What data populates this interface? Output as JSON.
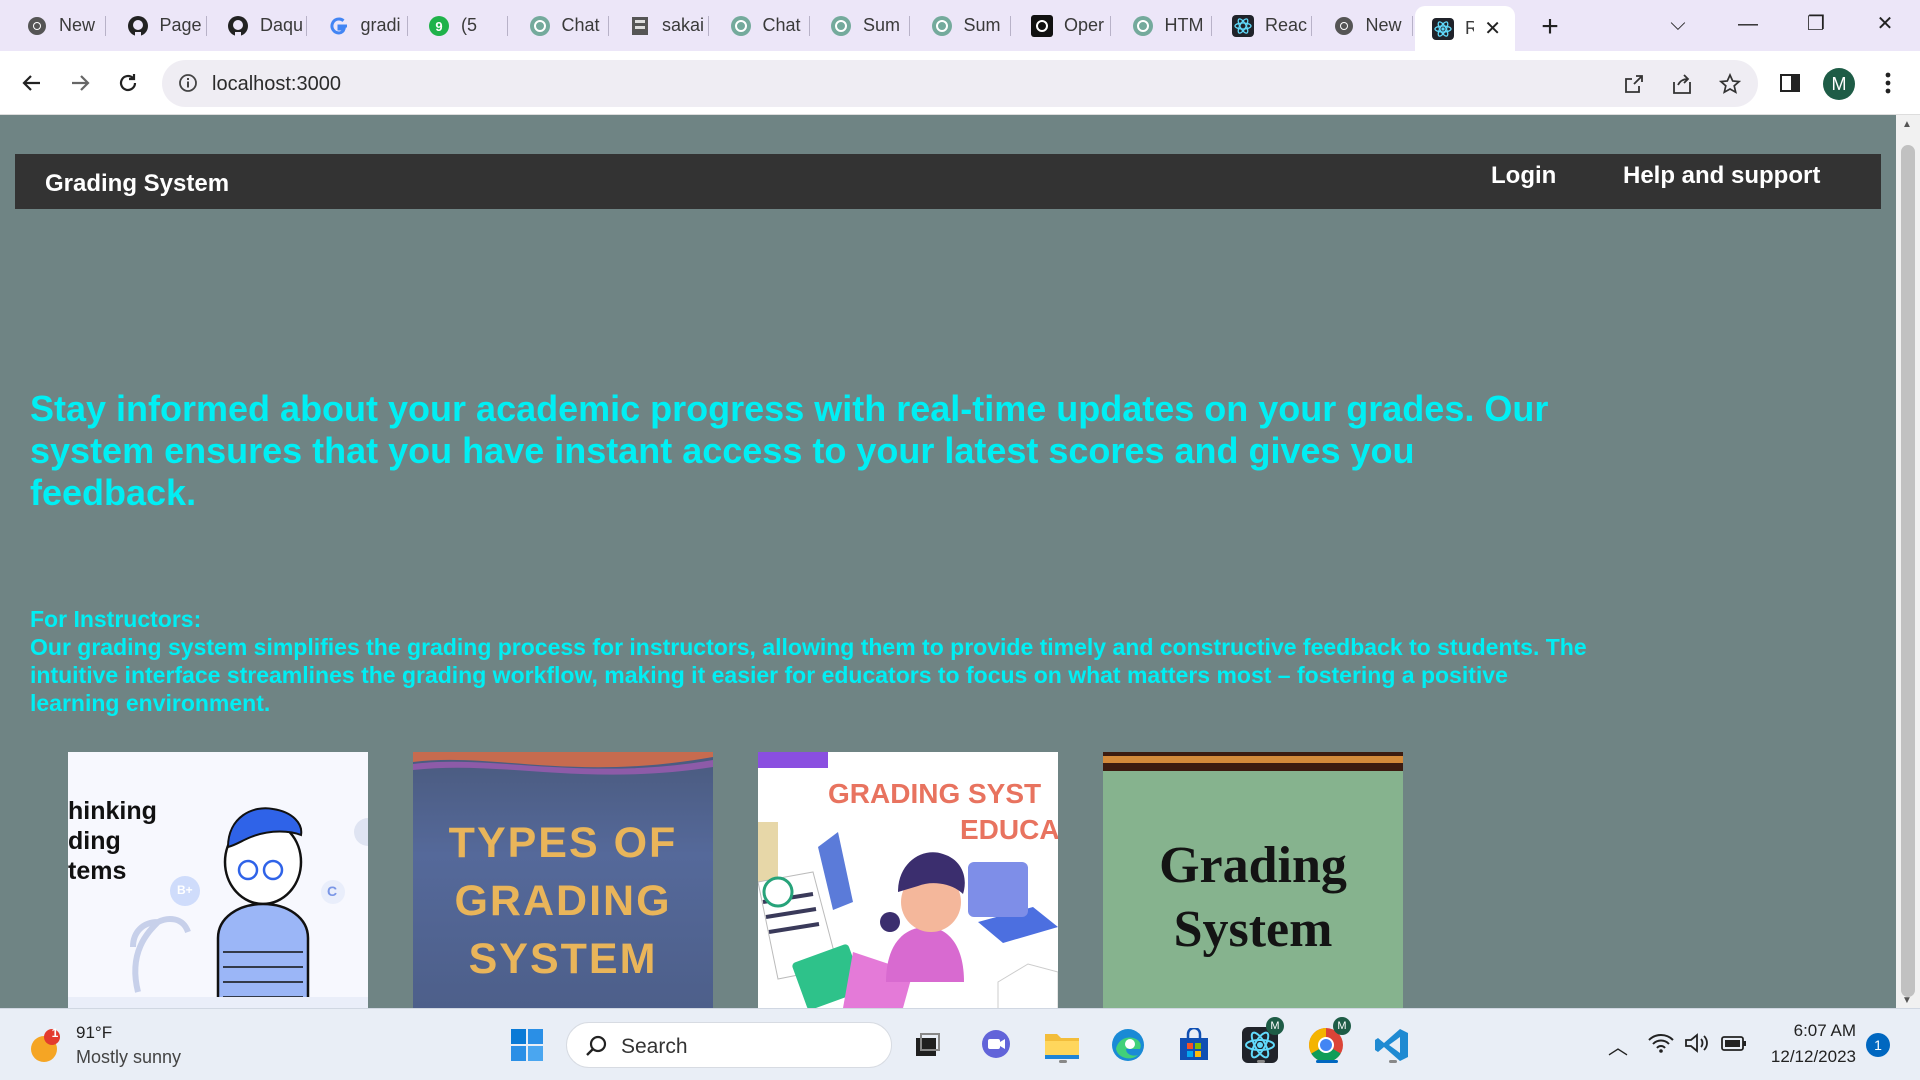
{
  "browser": {
    "tabs": [
      {
        "title": "New",
        "icon": "chrome-icon"
      },
      {
        "title": "Page",
        "icon": "github-icon"
      },
      {
        "title": "Daqu",
        "icon": "github-icon"
      },
      {
        "title": "gradi",
        "icon": "google-icon"
      },
      {
        "title": "(5",
        "icon": "app-9-icon"
      },
      {
        "title": "Chat",
        "icon": "chatgpt-icon"
      },
      {
        "title": "sakai",
        "icon": "sakai-icon"
      },
      {
        "title": "Chat",
        "icon": "chatgpt-icon"
      },
      {
        "title": "Sum",
        "icon": "chatgpt-icon"
      },
      {
        "title": "Sum",
        "icon": "chatgpt-icon"
      },
      {
        "title": "Oper",
        "icon": "openai-icon"
      },
      {
        "title": "HTM",
        "icon": "chatgpt-icon"
      },
      {
        "title": "Reac",
        "icon": "react-icon"
      },
      {
        "title": "New",
        "icon": "chrome-icon"
      }
    ],
    "active_tab": {
      "title": "R",
      "icon": "react-icon"
    },
    "url": "localhost:3000",
    "profile_initial": "M"
  },
  "site": {
    "brand": "Grading System",
    "nav": {
      "login": "Login",
      "help": "Help and support"
    },
    "hero": "Stay informed about your academic progress with real-time updates on your grades. Our system ensures that you have instant access to your latest scores and gives you feedback.",
    "instructors_heading": "For Instructors:",
    "instructors_body": "Our grading system simplifies the grading process for instructors, allowing them to provide timely and constructive feedback to students. The intuitive interface streamlines the grading workflow, making it easier for educators to focus on what matters most – fostering a positive learning environment.",
    "cards": [
      {
        "lines": [
          "hinking",
          "ding",
          "tems"
        ],
        "badges": [
          "B+",
          "C"
        ]
      },
      {
        "lines": [
          "TYPES OF",
          "GRADING",
          "SYSTEM"
        ]
      },
      {
        "lines": [
          "GRADING SYST",
          "EDUCA"
        ]
      },
      {
        "lines": [
          "Grading",
          "System"
        ]
      }
    ]
  },
  "taskbar": {
    "weather_temp": "91°F",
    "weather_desc": "Mostly sunny",
    "weather_badge": "1",
    "search_label": "Search",
    "time": "6:07 AM",
    "date": "12/12/2023",
    "notification_count": "1",
    "app_badge": "M"
  },
  "colors": {
    "accent_text": "#00eff4",
    "page_bg": "#6f8484",
    "nav_bg": "#333333"
  }
}
